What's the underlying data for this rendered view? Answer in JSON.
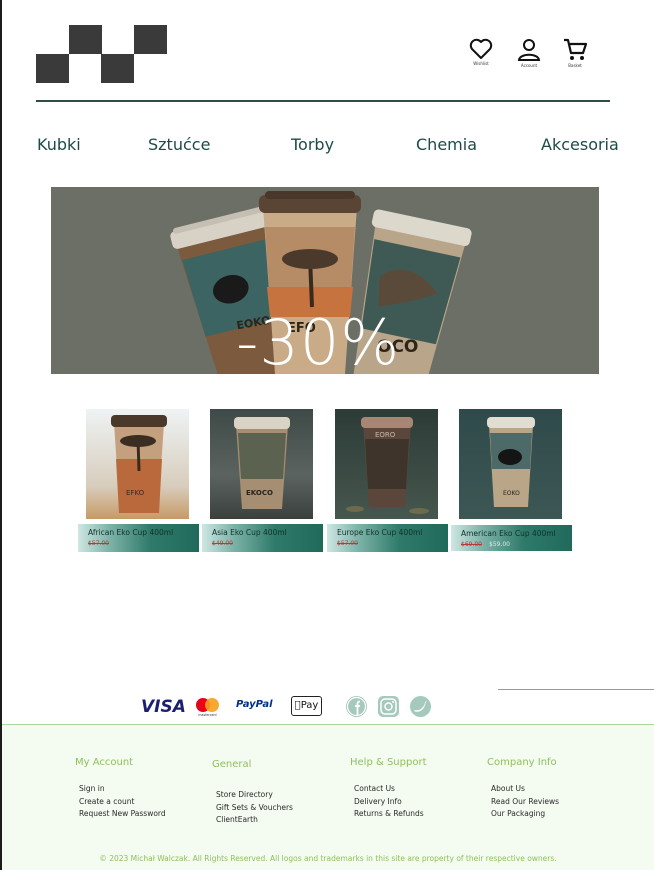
{
  "header": {
    "icons": [
      {
        "icon": "heart-icon",
        "label": "Wishlist"
      },
      {
        "icon": "user-icon",
        "label": "Account"
      },
      {
        "icon": "cart-icon",
        "label": "Basket"
      }
    ]
  },
  "nav": {
    "items": [
      "Kubki",
      "Sztućce",
      "Torby",
      "Chemia",
      "Akcesoria"
    ]
  },
  "hero": {
    "text": "-30%",
    "cup_labels": [
      "EOKO",
      "EFO",
      "OCO"
    ]
  },
  "products": [
    {
      "name": "African Eko Cup 400ml",
      "old_price": "$57.00",
      "new_price": "",
      "cup_text": "EFKO"
    },
    {
      "name": "Asia Eko Cup 400ml",
      "old_price": "$49.00",
      "new_price": "",
      "cup_text": "EKOCO"
    },
    {
      "name": "Europe Eko Cup 400ml",
      "old_price": "$57.00",
      "new_price": "",
      "cup_text": "EORO"
    },
    {
      "name": "American Eko Cup 400ml",
      "old_price": "$69.00",
      "new_price": "$59.00",
      "cup_text": "EOKO"
    }
  ],
  "payments": {
    "visa": "VISA",
    "mastercard": "mastercard",
    "paypal": "PayPal",
    "applepay": "Pay"
  },
  "social": [
    "facebook-icon",
    "instagram-icon",
    "twitter-icon"
  ],
  "footer": {
    "columns": [
      {
        "title": "My Account",
        "links": [
          "Sign in",
          "Create a count",
          "Request New Password"
        ]
      },
      {
        "title": "General",
        "links": [
          "Store Directory",
          "Gift Sets & Vouchers",
          "ClientEarth"
        ]
      },
      {
        "title": "Help & Support",
        "links": [
          "Contact Us",
          "Delivery Info",
          "Returns & Refunds"
        ]
      },
      {
        "title": "Company Info",
        "links": [
          "About Us",
          "Read Our Reviews",
          "Our Packaging"
        ]
      }
    ],
    "copyright": "© 2023 Michał Walczak. All Rights Reserved. All logos and trademarks in this site are property of their respective owners."
  },
  "colors": {
    "accent": "#8fc05d",
    "nav_text": "#1e4a48",
    "product_bar": "#2f7a6a",
    "hero_bg": "#6c6f66"
  }
}
